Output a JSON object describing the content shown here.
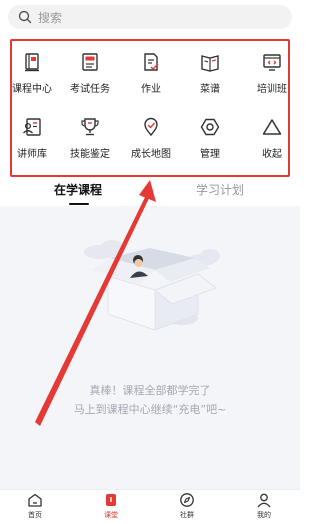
{
  "search": {
    "placeholder": "搜索"
  },
  "grid": {
    "items": [
      {
        "label": "课程中心",
        "icon": "course-center-icon"
      },
      {
        "label": "考试任务",
        "icon": "exam-task-icon"
      },
      {
        "label": "作业",
        "icon": "homework-icon"
      },
      {
        "label": "菜谱",
        "icon": "recipe-book-icon"
      },
      {
        "label": "培训班",
        "icon": "training-class-icon"
      },
      {
        "label": "讲师库",
        "icon": "lecturer-library-icon"
      },
      {
        "label": "技能鉴定",
        "icon": "skill-trophy-icon"
      },
      {
        "label": "成长地图",
        "icon": "growth-map-icon"
      },
      {
        "label": "管理",
        "icon": "manage-hexagon-icon"
      },
      {
        "label": "收起",
        "icon": "collapse-triangle-icon"
      }
    ]
  },
  "tabs": {
    "active": "在学课程",
    "inactive": "学习计划"
  },
  "empty": {
    "line1": "真棒！课程全部都学完了",
    "line2": "马上到课程中心继续“充电”吧~"
  },
  "nav": {
    "home": "首页",
    "classroom": "课堂",
    "community": "社群",
    "mine": "我的"
  },
  "colors": {
    "accent": "#e53935",
    "annotation": "#e53935"
  }
}
